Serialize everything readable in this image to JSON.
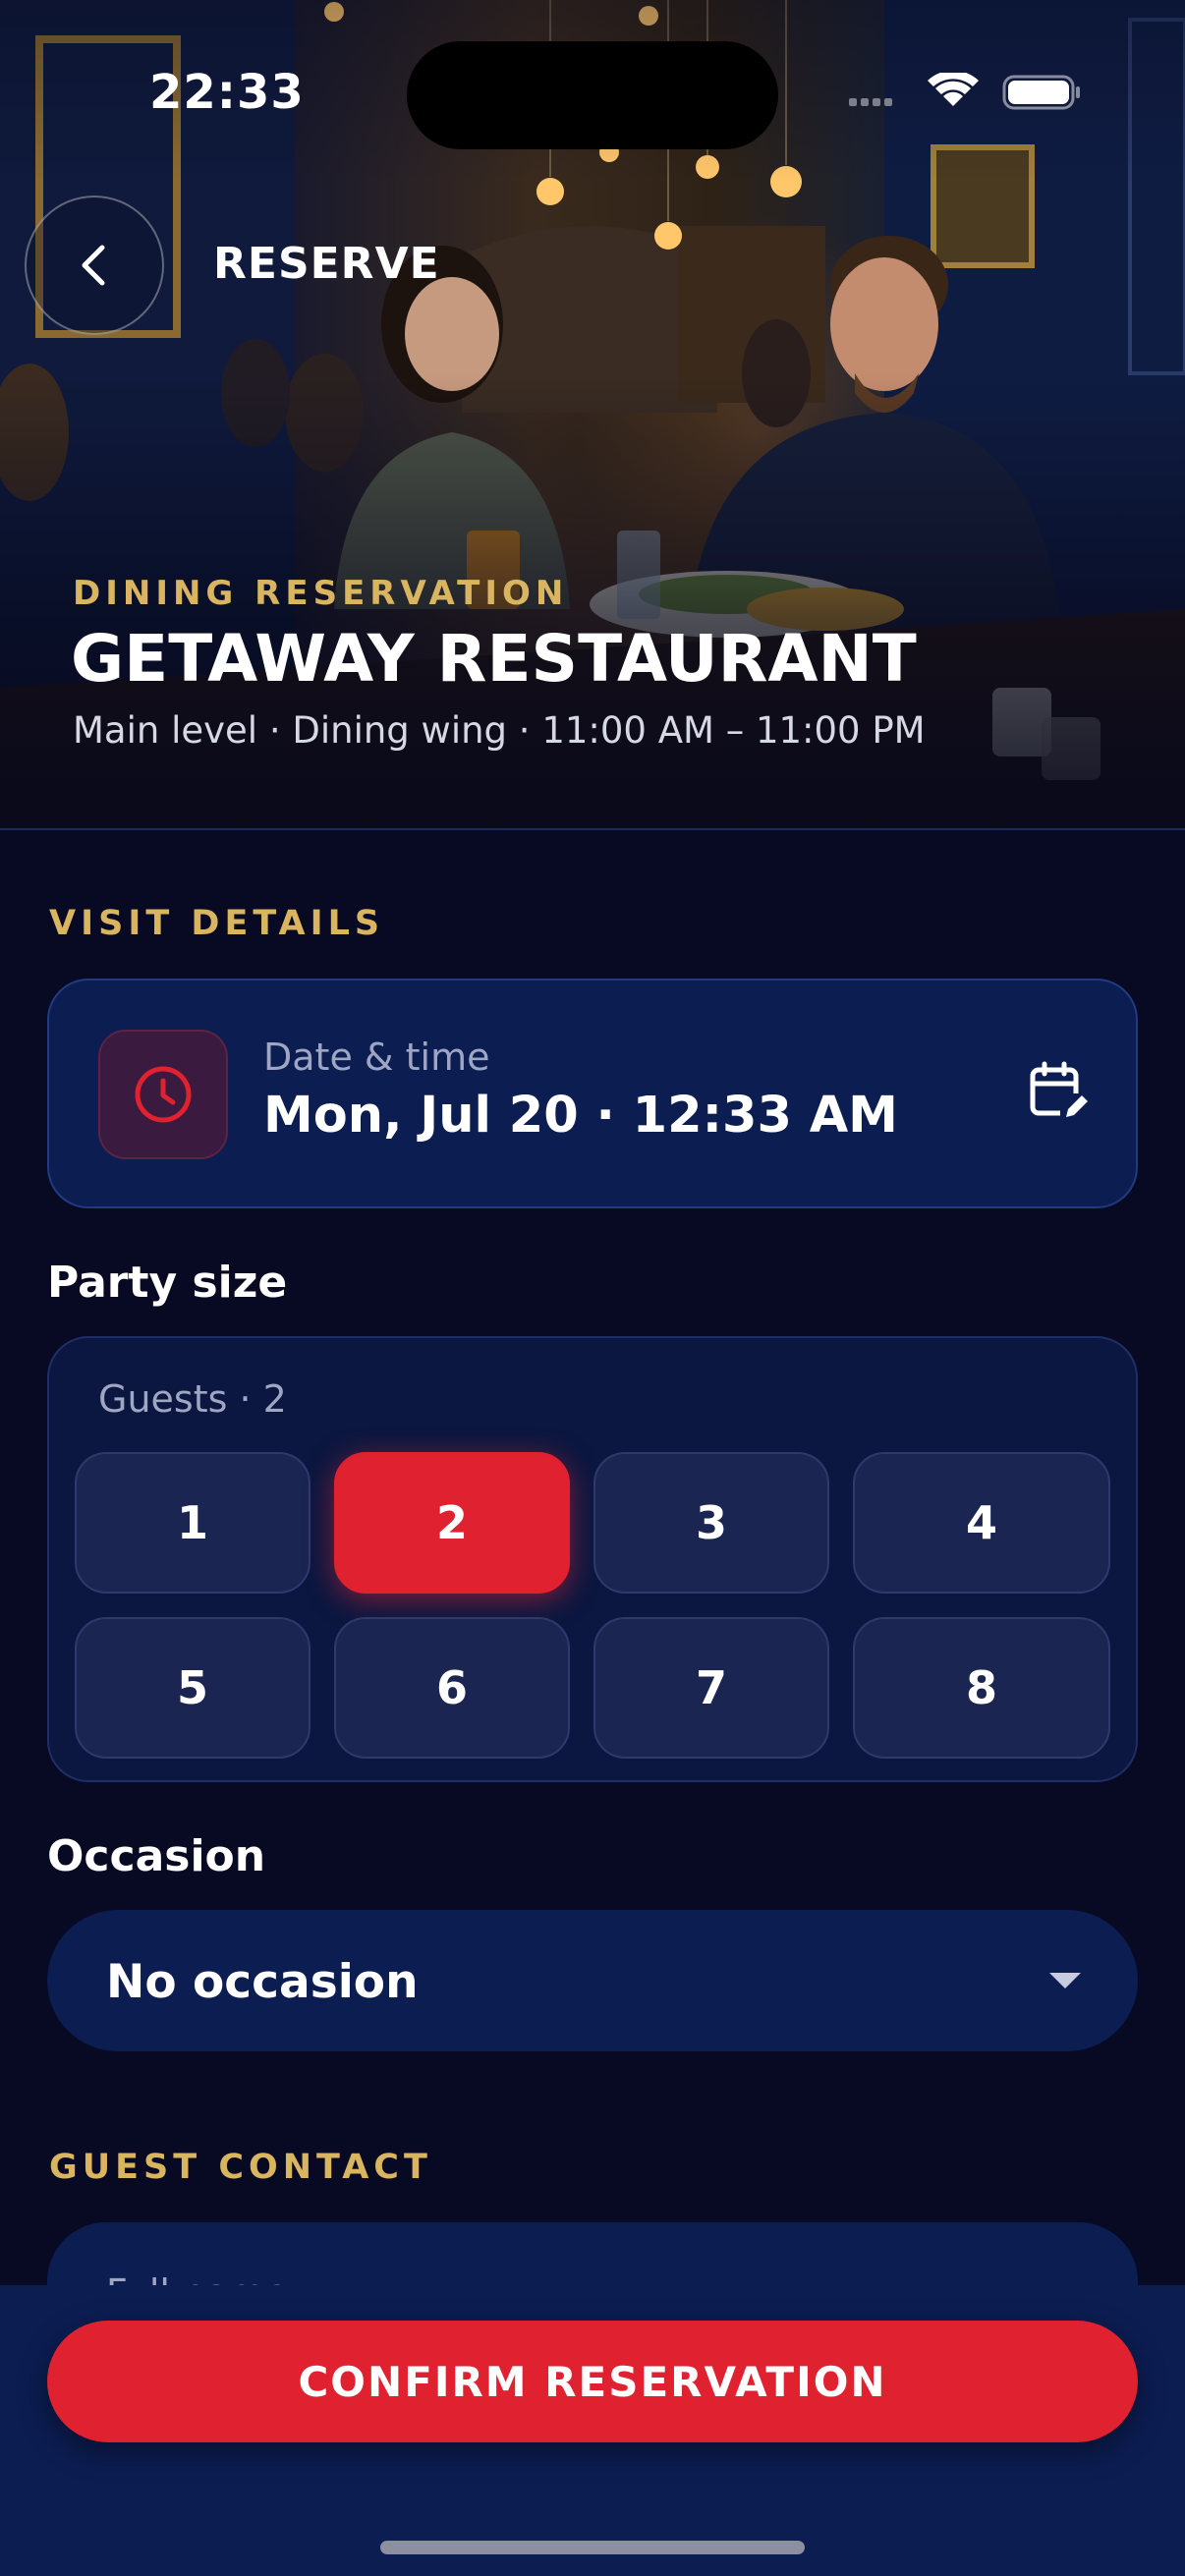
{
  "status_bar": {
    "time": "22:33"
  },
  "nav": {
    "back_icon": "chevron-left-icon",
    "title": "RESERVE"
  },
  "hero": {
    "eyebrow": "DINING RESERVATION",
    "name": "GETAWAY RESTAURANT",
    "meta": "Main level · Dining wing · 11:00 AM – 11:00 PM"
  },
  "visit_details": {
    "section_label": "VISIT DETAILS",
    "datetime": {
      "icon": "clock-icon",
      "label": "Date & time",
      "value": "Mon, Jul 20 · 12:33 AM",
      "edit_icon": "calendar-edit-icon"
    }
  },
  "party": {
    "label": "Party size",
    "guests_label": "Guests · 2",
    "options": [
      "1",
      "2",
      "3",
      "4",
      "5",
      "6",
      "7",
      "8"
    ],
    "selected": "2"
  },
  "occasion": {
    "label": "Occasion",
    "value": "No occasion",
    "caret_icon": "caret-down-icon"
  },
  "guest_contact": {
    "section_label": "GUEST CONTACT",
    "first_field_label": "Full name"
  },
  "footer": {
    "confirm_label": "CONFIRM RESERVATION"
  },
  "colors": {
    "background": "#080a24",
    "card": "#0c1d52",
    "accent_red": "#e0212f",
    "gold": "#d9b560"
  }
}
